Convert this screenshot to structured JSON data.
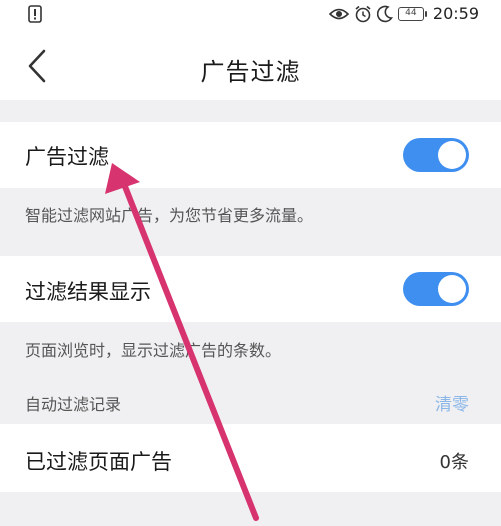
{
  "status_bar": {
    "time": "20:59",
    "battery": "44",
    "icons": [
      "alert-icon",
      "eye-icon",
      "alarm-icon",
      "moon-icon",
      "battery-icon"
    ]
  },
  "header": {
    "title": "广告过滤",
    "back_icon": "chevron-left-icon"
  },
  "ad_filter": {
    "label": "广告过滤",
    "enabled": true,
    "hint": "智能过滤网站广告，为您节省更多流量。"
  },
  "show_result": {
    "label": "过滤结果显示",
    "enabled": true,
    "hint": "页面浏览时，显示过滤广告的条数。"
  },
  "record": {
    "label": "自动过滤记录",
    "clear_label": "清零"
  },
  "filtered_pages": {
    "label": "已过滤页面广告",
    "count": "0条"
  },
  "colors": {
    "toggle_on": "#3f8ff1",
    "clear_link": "#8ab6e8",
    "annotation_arrow": "#d6336f",
    "background": "#f0f0f2"
  }
}
